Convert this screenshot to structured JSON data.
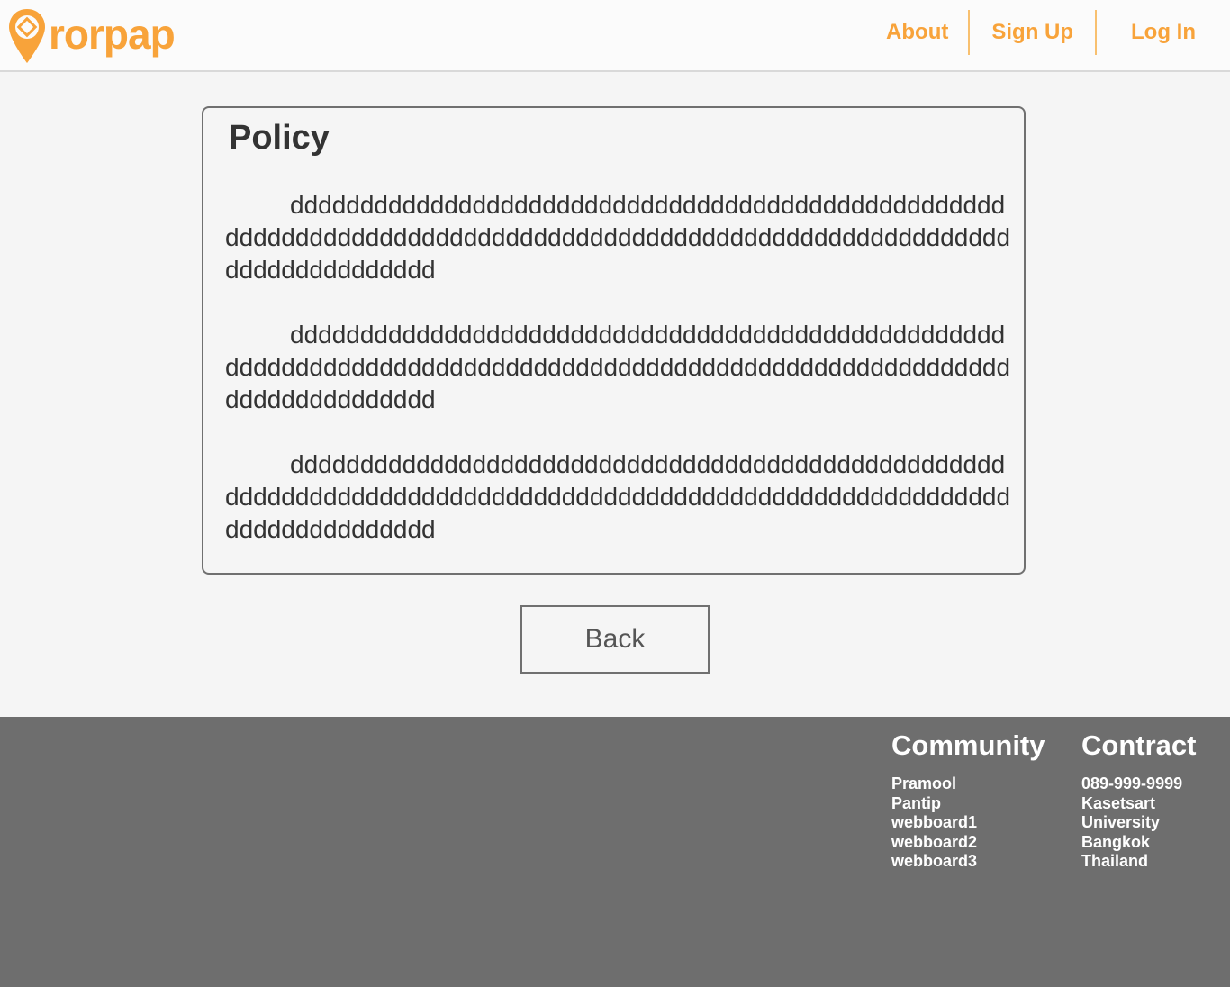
{
  "brand": {
    "name": "rorpap",
    "accent_color": "#f8a33a",
    "logo_icon": "map-pin-icon"
  },
  "nav": {
    "about": "About",
    "sign_up": "Sign Up",
    "log_in": "Log In"
  },
  "policy": {
    "title": "Policy",
    "paragraphs": [
      "dddddddddddddddddddddddddddddddddddddddddddddddddddddddddddddddddddddddddddddddddddddddddddddddddddddddddddddddddddddddddd",
      "dddddddddddddddddddddddddddddddddddddddddddddddddddddddddddddddddddddddddddddddddddddddddddddddddddddddddddddddddddddddddd",
      "dddddddddddddddddddddddddddddddddddddddddddddddddddddddddddddddddddddddddddddddddddddddddddddddddddddddddddddddddddddddddd"
    ]
  },
  "back_button": "Back",
  "footer": {
    "community": {
      "heading": "Community",
      "items": [
        "Pramool",
        "Pantip",
        "webboard1",
        "webboard2",
        "webboard3"
      ]
    },
    "contract": {
      "heading": "Contract",
      "items": [
        "089-999-9999",
        "Kasetsart",
        "University",
        "Bangkok",
        "Thailand"
      ]
    }
  }
}
